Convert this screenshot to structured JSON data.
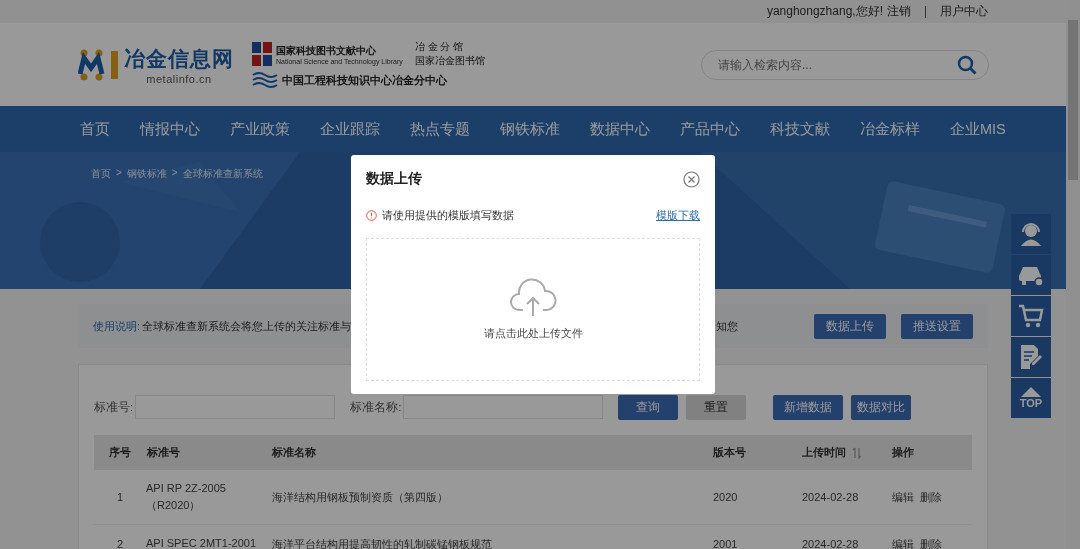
{
  "top_bar": {
    "greeting": "yanghongzhang,您好!",
    "logout": "注销",
    "user_center": "用户中心"
  },
  "header": {
    "logo_text": "冶金信息网",
    "logo_domain": "metalinfo.cn",
    "partner_1_name": "国家科技图书文献中心",
    "partner_1_en": "National Science and Technology Library",
    "partner_1_branch_1": "冶 金 分 馆",
    "partner_1_branch_2": "国家冶金图书馆",
    "partner_2_name": "中国工程科技知识中心冶金分中心",
    "search": {
      "placeholder": "请输入检索内容..."
    }
  },
  "nav": {
    "items": [
      {
        "label": "首页",
        "selected": false
      },
      {
        "label": "情报中心",
        "selected": false
      },
      {
        "label": "产业政策",
        "selected": false
      },
      {
        "label": "企业跟踪",
        "selected": false
      },
      {
        "label": "热点专题",
        "selected": false
      },
      {
        "label": "钢铁标准",
        "selected": false
      },
      {
        "label": "数据中心",
        "selected": false
      },
      {
        "label": "产品中心",
        "selected": false
      },
      {
        "label": "科技文献",
        "selected": false
      },
      {
        "label": "冶金标样",
        "selected": false
      },
      {
        "label": "企业MIS",
        "selected": false
      }
    ]
  },
  "breadcrumb": {
    "separator": ">",
    "items": [
      "首页",
      "钢铁标准",
      "全球标准查新系统"
    ]
  },
  "usage": {
    "label": "使用说明:",
    "text_start": "全球标准查新系统会将您上传的关注标准与",
    "text_end": "知您",
    "buttons": [
      "数据上传",
      "推送设置"
    ]
  },
  "form": {
    "fields": [
      {
        "label": "标准号:"
      },
      {
        "label": "标准名称:"
      }
    ],
    "buttons": [
      {
        "label": "查询",
        "kind": "primary"
      },
      {
        "label": "重置",
        "kind": "secondary"
      },
      {
        "label": "新增数据",
        "kind": "primary"
      },
      {
        "label": "数据对比",
        "kind": "primary"
      }
    ]
  },
  "table": {
    "columns": [
      {
        "label": "序号",
        "sortable": false
      },
      {
        "label": "标准号",
        "sortable": false
      },
      {
        "label": "标准名称",
        "sortable": false
      },
      {
        "label": "版本号",
        "sortable": false
      },
      {
        "label": "上传时间",
        "sortable": true
      },
      {
        "label": "操作",
        "sortable": false
      }
    ],
    "rows": [
      {
        "index": "1",
        "number": "API RP 2Z-2005（R2020）",
        "name": "海洋结构用钢板预制资质（第四版）",
        "version": "2020",
        "uploaded": "2024-02-28",
        "actions": [
          "编辑",
          "删除"
        ]
      },
      {
        "index": "2",
        "number": "API SPEC 2MT1-2001",
        "name": "海洋平台结构用提高韧性的轧制碳锰钢板规范",
        "version": "2001",
        "uploaded": "2024-02-28",
        "actions": [
          "编辑",
          "删除"
        ]
      }
    ]
  },
  "side_tools": [
    {
      "kind": "service"
    },
    {
      "kind": "car"
    },
    {
      "kind": "cart"
    },
    {
      "kind": "edit"
    },
    {
      "kind": "top",
      "label": "TOP"
    }
  ],
  "dialog": {
    "title": "数据上传",
    "notice": "请使用提供的模版填写数据",
    "template_link": "模版下载",
    "upload_hint": "请点击此处上传文件"
  }
}
